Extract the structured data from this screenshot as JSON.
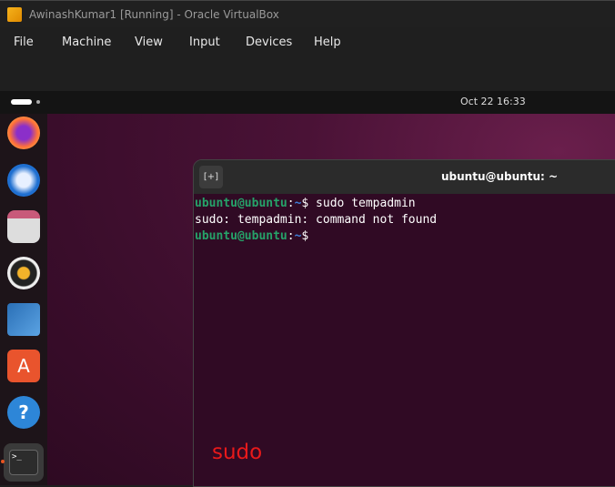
{
  "window": {
    "title": "AwinashKumar1 [Running] - Oracle VirtualBox"
  },
  "menu": [
    "File",
    "Machine",
    "View",
    "Input",
    "Devices",
    "Help"
  ],
  "topbar": {
    "clock": "Oct 22  16:33"
  },
  "dock": [
    "firefox-icon",
    "thunderbird-icon",
    "files-icon",
    "rhythmbox-icon",
    "libreoffice-writer-icon",
    "app-center-icon",
    "help-icon",
    "terminal-icon"
  ],
  "terminal": {
    "newtab": "[+]",
    "title": "ubuntu@ubuntu: ~",
    "lines": [
      {
        "user": "ubuntu@ubuntu",
        "path": "~",
        "cmd": " sudo tempadmin"
      },
      {
        "output": "sudo: tempadmin: command not found"
      },
      {
        "user": "ubuntu@ubuntu",
        "path": "~",
        "cmd": ""
      }
    ]
  },
  "annotation": "sudo",
  "colors": {
    "desktop": "#3a0d2b",
    "terminal_bg": "#300a24",
    "prompt_user": "#26a269",
    "prompt_path": "#3f7fd8",
    "annotation": "#e8191a"
  }
}
